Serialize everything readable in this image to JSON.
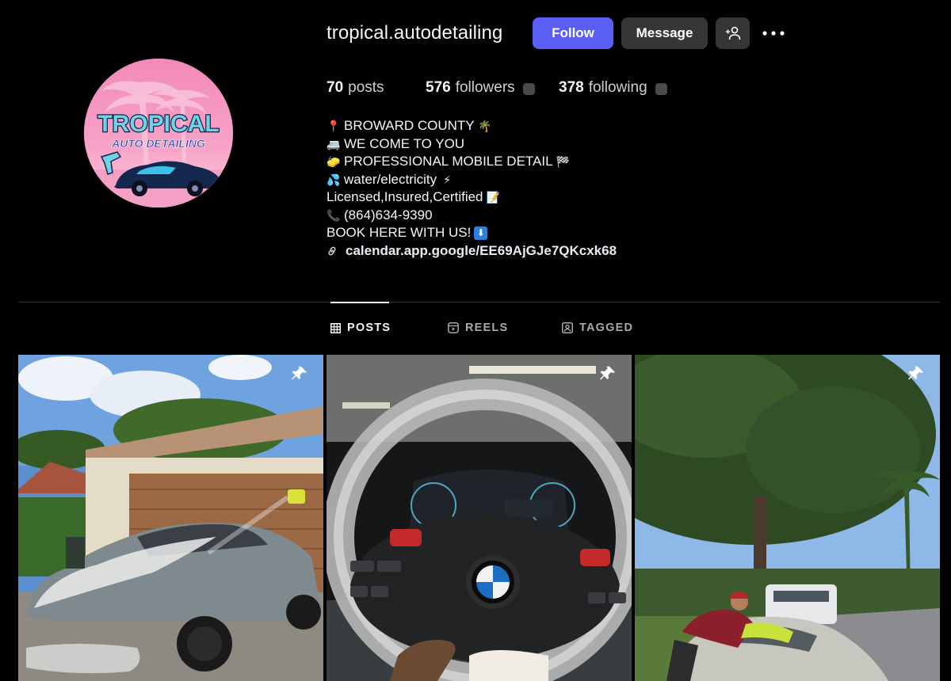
{
  "profile": {
    "username": "tropical.autodetailing",
    "avatar_icon": "tropical-auto-detailing-logo",
    "logo_text_1": "TROPICAL",
    "logo_text_2": "AUTO DETAILING"
  },
  "actions": {
    "follow_label": "Follow",
    "message_label": "Message",
    "add_user_icon": "person-plus-icon",
    "more_icon": "ellipsis-icon",
    "accent_color": "#5b5ff6"
  },
  "stats": {
    "posts_count": "70",
    "posts_label": "posts",
    "followers_count": "576",
    "followers_label": "followers",
    "following_count": "378",
    "following_label": "following"
  },
  "bio": {
    "lines": [
      {
        "emoji": "📍",
        "text": "BROWARD COUNTY",
        "trail": "🌴"
      },
      {
        "emoji": "🚐",
        "text": "WE COME TO YOU",
        "trail": ""
      },
      {
        "emoji": "🧽",
        "text": "PROFESSIONAL MOBILE DETAIL",
        "trail": "🏁"
      },
      {
        "emoji": "💦",
        "text": "water/electricity",
        "trail": "⚡"
      },
      {
        "emoji": "",
        "text": "Licensed,Insured,Certified ",
        "trail": "📝"
      },
      {
        "emoji": "📞",
        "text": "(864)634-9390",
        "trail": ""
      },
      {
        "emoji": "",
        "text": "BOOK HERE WITH US!",
        "trail": "⬇"
      }
    ],
    "link_text": "calendar.app.google/EE69AjGJe7QKcxk68"
  },
  "tabs": [
    {
      "label": "POSTS",
      "icon": "grid-icon",
      "active": true
    },
    {
      "label": "REELS",
      "icon": "reels-icon",
      "active": false
    },
    {
      "label": "TAGGED",
      "icon": "tagged-icon",
      "active": false
    }
  ],
  "posts": [
    {
      "description": "grey-porsche-foam-wash",
      "pinned": true
    },
    {
      "description": "bmw-steering-wheel-interior",
      "pinned": true
    },
    {
      "description": "detailer-wiping-car-hood",
      "pinned": true
    }
  ]
}
